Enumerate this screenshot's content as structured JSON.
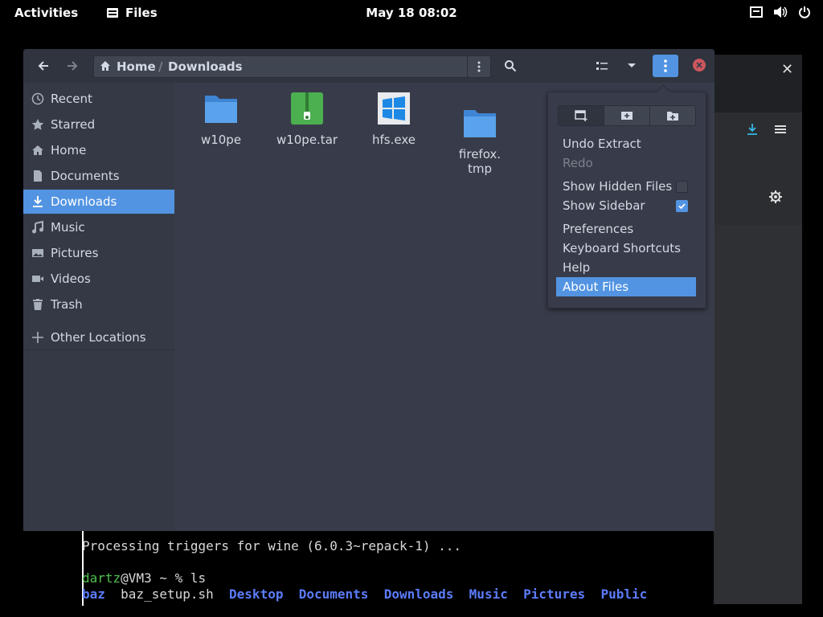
{
  "topbar": {
    "activities": "Activities",
    "app_name": "Files",
    "clock": "May 18  08:02",
    "tray_icons": [
      "network-icon",
      "volume-icon",
      "power-icon"
    ]
  },
  "window": {
    "breadcrumb": {
      "home": "Home",
      "separator": "/",
      "current": "Downloads"
    },
    "colors": {
      "accent": "#5294e2",
      "background": "#383c4a",
      "sidebar": "#353945",
      "close": "#cc575d"
    }
  },
  "sidebar": {
    "items": [
      {
        "label": "Recent",
        "icon": "clock-icon"
      },
      {
        "label": "Starred",
        "icon": "star-icon"
      },
      {
        "label": "Home",
        "icon": "home-icon"
      },
      {
        "label": "Documents",
        "icon": "document-icon"
      },
      {
        "label": "Downloads",
        "icon": "download-icon",
        "active": true
      },
      {
        "label": "Music",
        "icon": "music-icon"
      },
      {
        "label": "Pictures",
        "icon": "picture-icon"
      },
      {
        "label": "Videos",
        "icon": "video-icon"
      },
      {
        "label": "Trash",
        "icon": "trash-icon"
      }
    ],
    "other": {
      "label": "Other Locations",
      "icon": "plus-icon"
    }
  },
  "files": [
    {
      "name": "w10pe",
      "icon": "folder-icon"
    },
    {
      "name": "w10pe.tar",
      "icon": "archive-icon"
    },
    {
      "name": "hfs.exe",
      "icon": "windows-exe-icon"
    },
    {
      "name": "firefox.\ntmp",
      "icon": "folder-icon"
    }
  ],
  "menu": {
    "tabs": [
      "new-window-icon",
      "new-tab-icon",
      "new-folder-icon"
    ],
    "undo": "Undo Extract",
    "redo": "Redo",
    "show_hidden": "Show Hidden Files",
    "show_hidden_checked": false,
    "show_sidebar": "Show Sidebar",
    "show_sidebar_checked": true,
    "preferences": "Preferences",
    "shortcuts": "Keyboard Shortcuts",
    "help": "Help",
    "about": "About Files"
  },
  "terminal": {
    "line1": "Processing triggers for wine (6.0.3~repack-1) ...",
    "prompt_user": "dartz",
    "prompt_rest": "@VM3 ~ % ls",
    "ls": [
      "baz",
      "baz_setup.sh",
      "Desktop",
      "Documents",
      "Downloads",
      "Music",
      "Pictures",
      "Public"
    ]
  }
}
